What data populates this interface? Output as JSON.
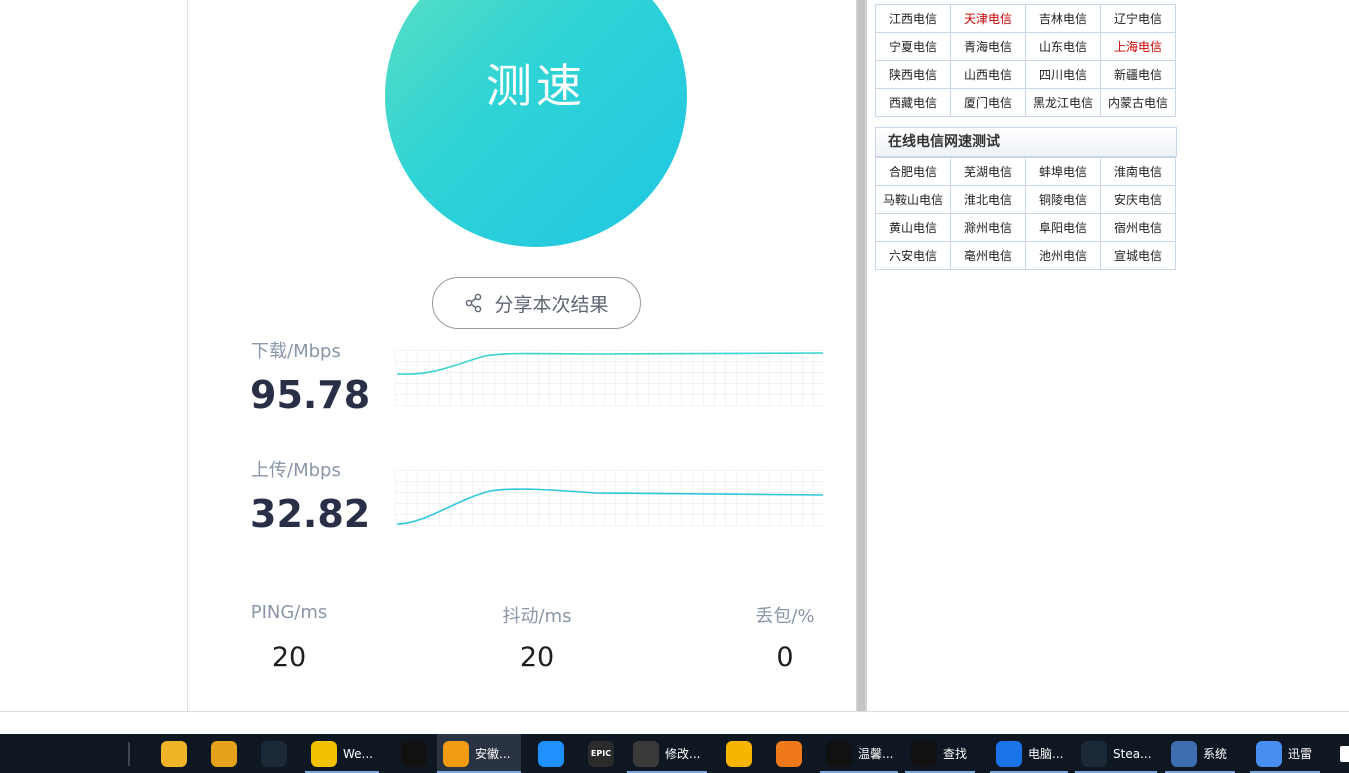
{
  "speedtest": {
    "start_label": "测速",
    "share_label": "分享本次结果",
    "download": {
      "label": "下载/Mbps",
      "value": "95.78"
    },
    "upload": {
      "label": "上传/Mbps",
      "value": "32.82"
    },
    "ping": {
      "label": "PING/ms",
      "value": "20"
    },
    "jitter": {
      "label": "抖动/ms",
      "value": "20"
    },
    "loss": {
      "label": "丢包/%",
      "value": "0"
    },
    "line_color": "#3ad3d3"
  },
  "telecom_table_1": {
    "rows": [
      [
        "江西电信",
        "天津电信",
        "吉林电信",
        "辽宁电信"
      ],
      [
        "宁夏电信",
        "青海电信",
        "山东电信",
        "上海电信"
      ],
      [
        "陕西电信",
        "山西电信",
        "四川电信",
        "新疆电信"
      ],
      [
        "西藏电信",
        "厦门电信",
        "黑龙江电信",
        "内蒙古电信"
      ]
    ],
    "highlighted": [
      "天津电信",
      "上海电信"
    ]
  },
  "telecom_table_2": {
    "title": "在线电信网速测试",
    "rows": [
      [
        "合肥电信",
        "芜湖电信",
        "蚌埠电信",
        "淮南电信"
      ],
      [
        "马鞍山电信",
        "淮北电信",
        "铜陵电信",
        "安庆电信"
      ],
      [
        "黄山电信",
        "滁州电信",
        "阜阳电信",
        "宿州电信"
      ],
      [
        "六安电信",
        "亳州电信",
        "池州电信",
        "宣城电信"
      ]
    ]
  },
  "taskbar": {
    "items": [
      {
        "name": "file-explorer",
        "label": "",
        "icon": "folder-icon",
        "color": "#f0b429"
      },
      {
        "name": "cat-app",
        "label": "",
        "icon": "cat-icon",
        "color": "#e7a21c"
      },
      {
        "name": "steam",
        "label": "",
        "icon": "steam-icon",
        "color": "#1b2838"
      },
      {
        "name": "we",
        "label": "We...",
        "icon": "we-icon",
        "color": "#f2c200"
      },
      {
        "name": "qq-1",
        "label": "",
        "icon": "qq-icon",
        "color": "#111111"
      },
      {
        "name": "uc-browser",
        "label": "安徽...",
        "icon": "uc-icon",
        "color": "#f39c12"
      },
      {
        "name": "browser-q",
        "label": "",
        "icon": "q-browser-icon",
        "color": "#1e90ff"
      },
      {
        "name": "epic",
        "label": "",
        "icon": "epic-icon",
        "color": "#2b2b2b",
        "text": "EPIC"
      },
      {
        "name": "modifier",
        "label": "修改...",
        "icon": "dragon-icon",
        "color": "#3a3a3a"
      },
      {
        "name": "speed-app",
        "label": "",
        "icon": "speed-icon",
        "color": "#f7b500"
      },
      {
        "name": "orange-bird",
        "label": "",
        "icon": "bird-icon",
        "color": "#f07a1a"
      },
      {
        "name": "qq-2",
        "label": "温馨...",
        "icon": "qq-icon",
        "color": "#111111"
      },
      {
        "name": "qq-3",
        "label": "查找",
        "icon": "qq-icon",
        "color": "#111111"
      },
      {
        "name": "pc-manager",
        "label": "电脑...",
        "icon": "shield-icon",
        "color": "#1a73e8"
      },
      {
        "name": "steam-2",
        "label": "Stea...",
        "icon": "steam-icon",
        "color": "#1b2838"
      },
      {
        "name": "system",
        "label": "系统",
        "icon": "laptop-icon",
        "color": "#3d6fb0"
      },
      {
        "name": "xunlei",
        "label": "迅雷",
        "icon": "xunlei-icon",
        "color": "#4a8df0"
      }
    ]
  }
}
